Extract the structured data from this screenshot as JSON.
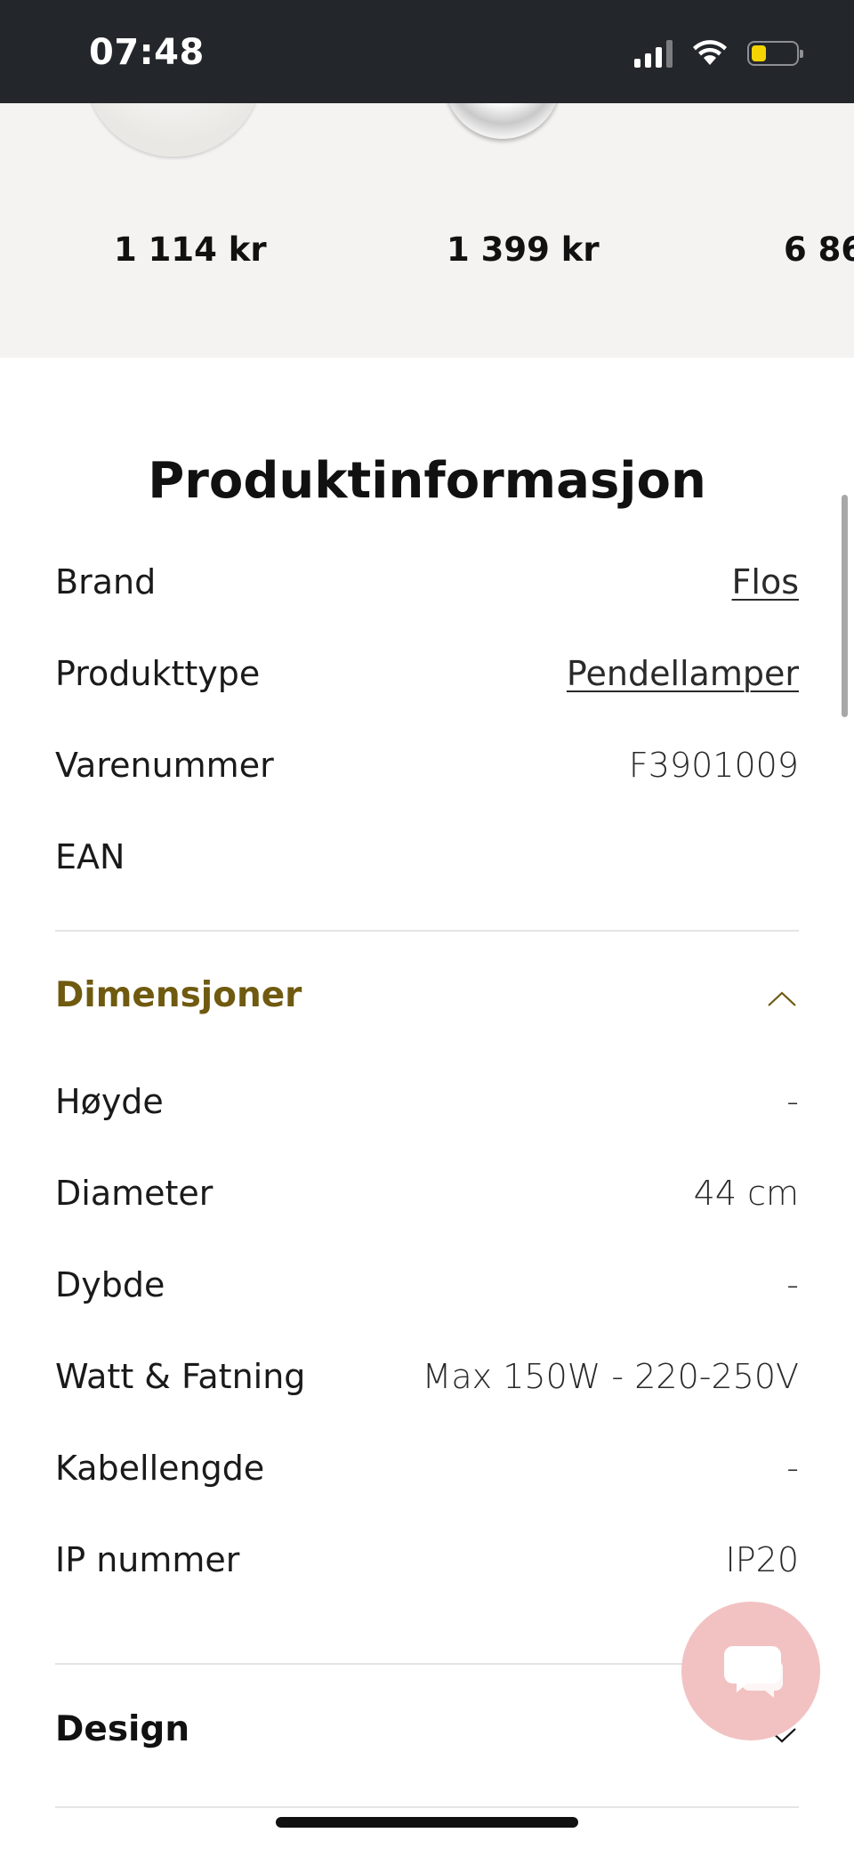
{
  "status_bar": {
    "time": "07:48"
  },
  "carousel": {
    "prices": [
      "1 114 kr",
      "1 399 kr",
      "6 86"
    ]
  },
  "product_info": {
    "title": "Produktinformasjon",
    "rows": [
      {
        "label": "Brand",
        "value": "Flos"
      },
      {
        "label": "Produkttype",
        "value": "Pendellamper"
      },
      {
        "label": "Varenummer",
        "value": "F3901009"
      },
      {
        "label": "EAN",
        "value": ""
      }
    ]
  },
  "dimensions": {
    "title": "Dimensjoner",
    "title_color": "#6f5a10",
    "expanded": true,
    "rows": [
      {
        "label": "Høyde",
        "value": "-"
      },
      {
        "label": "Diameter",
        "value": "44 cm"
      },
      {
        "label": "Dybde",
        "value": "-"
      },
      {
        "label": "Watt & Fatning",
        "value": "Max 150W - 220-250V"
      },
      {
        "label": "Kabellengde",
        "value": "-"
      },
      {
        "label": "IP nummer",
        "value": "IP20"
      }
    ]
  },
  "design": {
    "title": "Design",
    "expanded": false
  },
  "chat_button": {
    "icon": "chat-bubbles-icon",
    "color": "#f2c2c2"
  }
}
